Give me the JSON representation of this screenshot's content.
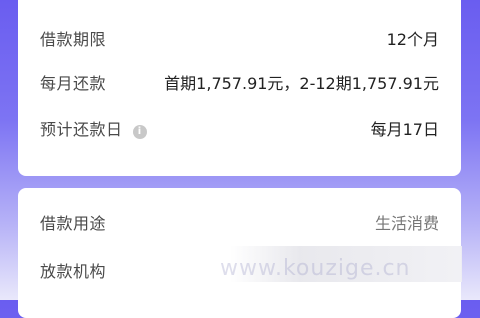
{
  "loan_terms": {
    "term_label": "借款期限",
    "term_value": "12个月",
    "monthly_label": "每月还款",
    "monthly_value": "首期1,757.91元，2-12期1,757.91元",
    "due_label": "预计还款日",
    "due_info_icon": "info-icon",
    "due_value": "每月17日"
  },
  "loan_details": {
    "purpose_label": "借款用途",
    "purpose_value": "生活消费",
    "lender_label": "放款机构"
  },
  "watermark": "www.kouzige.cn"
}
